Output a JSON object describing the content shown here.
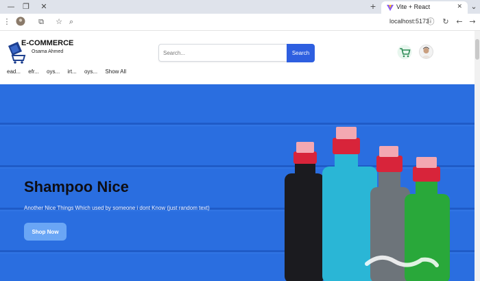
{
  "browser": {
    "tab_title": "Vite + React",
    "url": "localhost:5173"
  },
  "header": {
    "brand": "E-COMMERCE",
    "brand_sub": "Osama Ahmed",
    "search_placeholder": "Search...",
    "search_button": "Search"
  },
  "categories": [
    "ead...",
    "efr...",
    "oys...",
    "irt...",
    "oys...",
    "Show All"
  ],
  "hero": {
    "title": "Shampoo Nice",
    "description": "Another Nice Things Which used by someone i dont Know (just random text)",
    "cta": "Shop Now"
  },
  "colors": {
    "accent": "#2e5fe0",
    "hero_bg": "#2a6ee0",
    "cta_bg": "#6aa6f5"
  }
}
